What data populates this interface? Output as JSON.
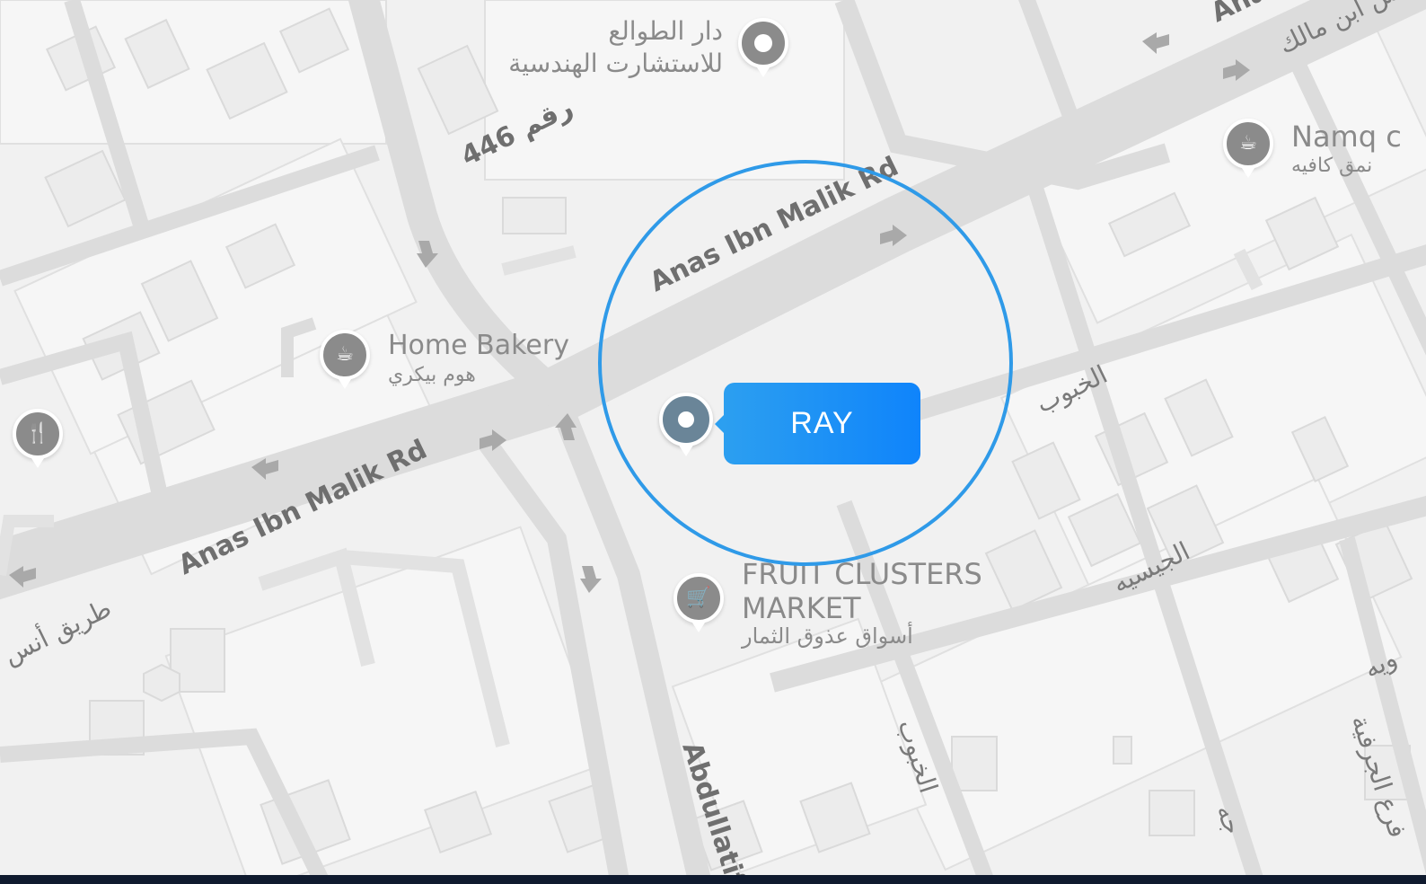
{
  "map": {
    "roads": {
      "main_road_en_1": "Anas Ibn Malik Rd",
      "main_road_en_2": "Anas Ibn Malik Rd",
      "main_road_en_top": "Ana",
      "main_road_ar_left": "طريق أنس",
      "main_road_ar_top": "أنس ابن مالك",
      "road_446": "446 رقم",
      "abdullatif": "Abdullatif",
      "khabub_1": "الخبوب",
      "khabub_2": "الخبوب",
      "jisiyah": "الجيسيه",
      "jarfiyah": "فرع الجرفية",
      "right_edge": "ويه",
      "bottom_partial": "جه"
    },
    "pois": [
      {
        "title": "دار الطوالع",
        "subtitle": "للاستشارت الهندسية",
        "icon": "pin-dot-icon"
      },
      {
        "title": "Home Bakery",
        "subtitle": "هوم بيكري",
        "icon": "coffee-cup-icon"
      },
      {
        "title": "Namq c",
        "subtitle": "نمق كافيه",
        "icon": "coffee-cup-icon"
      },
      {
        "title": "FRUIT CLUSTERS",
        "title2": "MARKET",
        "subtitle": "أسواق عذوق الثمار",
        "icon": "shopping-cart-icon"
      },
      {
        "title": "",
        "subtitle": "",
        "icon": "fork-knife-icon"
      }
    ]
  },
  "marker": {
    "label": "RAY",
    "ring_color": "#2f9ae8",
    "label_color": "#1a8ef5",
    "pin_color": "#6a8598"
  },
  "colors": {
    "map_bg": "#f1f1f1",
    "road": "#dcdcdc",
    "bottom_bar": "#0f1a2e"
  }
}
